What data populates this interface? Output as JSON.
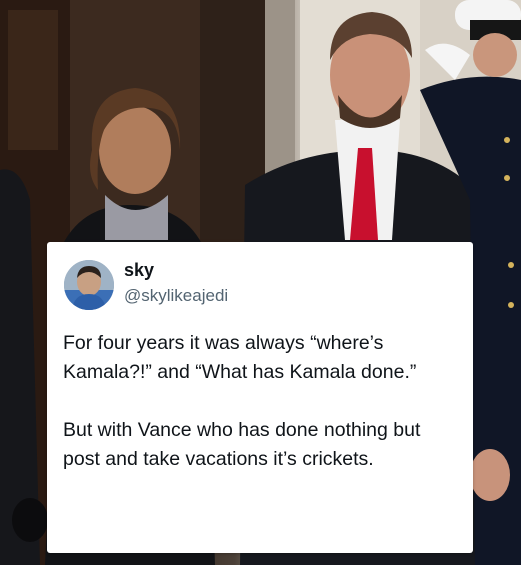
{
  "post": {
    "display_name": "sky",
    "handle": "@skylikeajedi",
    "text": "For four years it was always “where’s Kamala?!” and “What has Kamala done.”\n\nBut with Vance who has done nothing but post and take vacations it’s crickets."
  },
  "icons": [
    "avatar-image"
  ],
  "colors": {
    "text": "#0f1419",
    "handle": "#536471",
    "card": "#ffffff"
  }
}
